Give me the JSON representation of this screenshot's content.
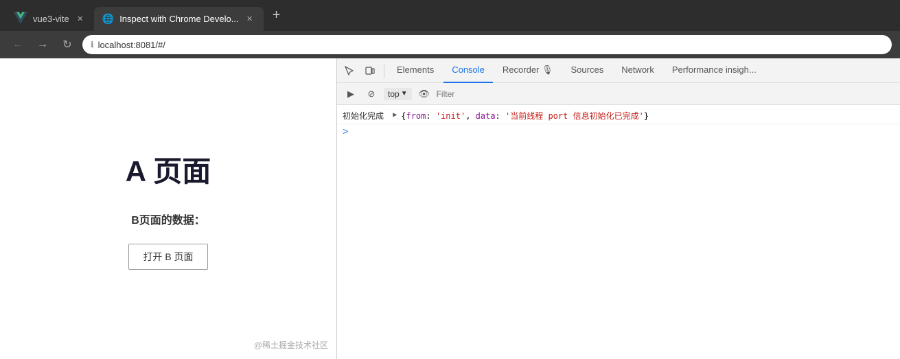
{
  "browser": {
    "tabs": [
      {
        "id": "vue-tab",
        "label": "vue3-vite",
        "type": "vue",
        "active": false,
        "closable": true
      },
      {
        "id": "inspect-tab",
        "label": "Inspect with Chrome Develo...",
        "type": "globe",
        "active": true,
        "closable": true
      }
    ],
    "new_tab_label": "+",
    "address": "localhost:8081/#/",
    "address_prefix": "localhost",
    "nav_back": "←",
    "nav_forward": "→",
    "nav_reload": "↻"
  },
  "page": {
    "title": "A 页面",
    "subtitle": "B页面的数据：",
    "open_button": "打开 B 页面",
    "watermark": "@稀土掘金技术社区"
  },
  "devtools": {
    "tabs": [
      {
        "id": "elements",
        "label": "Elements",
        "active": false
      },
      {
        "id": "console",
        "label": "Console",
        "active": true
      },
      {
        "id": "recorder",
        "label": "Recorder 🎙",
        "active": false
      },
      {
        "id": "sources",
        "label": "Sources",
        "active": false
      },
      {
        "id": "network",
        "label": "Network",
        "active": false
      },
      {
        "id": "performance",
        "label": "Performance insigh...",
        "active": false
      }
    ],
    "toolbar_icons": [
      "cursor",
      "layout"
    ],
    "console_bar": {
      "top_label": "top",
      "filter_placeholder": "Filter"
    },
    "console_entries": [
      {
        "prefix": "初始化完成",
        "arrow": "▶",
        "content": "{from: 'init', data: '当前线程 port 信息初始化已完成'}"
      }
    ],
    "prompt": ">"
  }
}
